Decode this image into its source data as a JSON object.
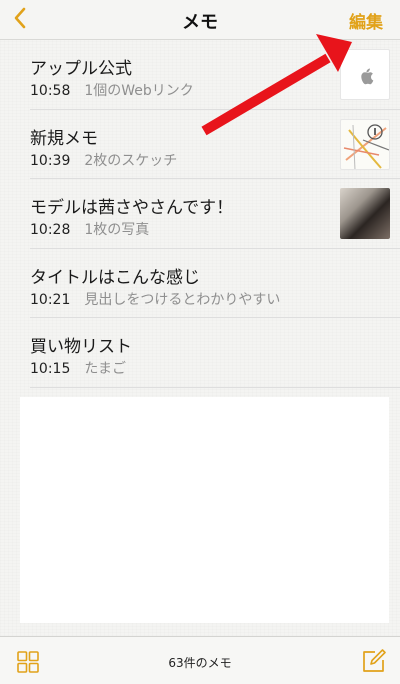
{
  "nav": {
    "title": "メモ",
    "edit_label": "編集"
  },
  "notes": [
    {
      "title": "アップル公式",
      "time": "10:58",
      "preview": "1個のWebリンク",
      "thumb": "apple-logo-icon"
    },
    {
      "title": "新規メモ",
      "time": "10:39",
      "preview": "2枚のスケッチ",
      "thumb": "sketch-icon"
    },
    {
      "title": "モデルは茜さやさんです！",
      "time": "10:28",
      "preview": "1枚の写真",
      "thumb": "photo"
    },
    {
      "title": "タイトルはこんな感じ",
      "time": "10:21",
      "preview": "見出しをつけるとわかりやすい",
      "thumb": ""
    },
    {
      "title": "買い物リスト",
      "time": "10:15",
      "preview": "たまご",
      "thumb": ""
    }
  ],
  "toolbar": {
    "count_label": "63件のメモ"
  },
  "colors": {
    "accent": "#e1a21a",
    "annotation_arrow": "#e8141b"
  }
}
